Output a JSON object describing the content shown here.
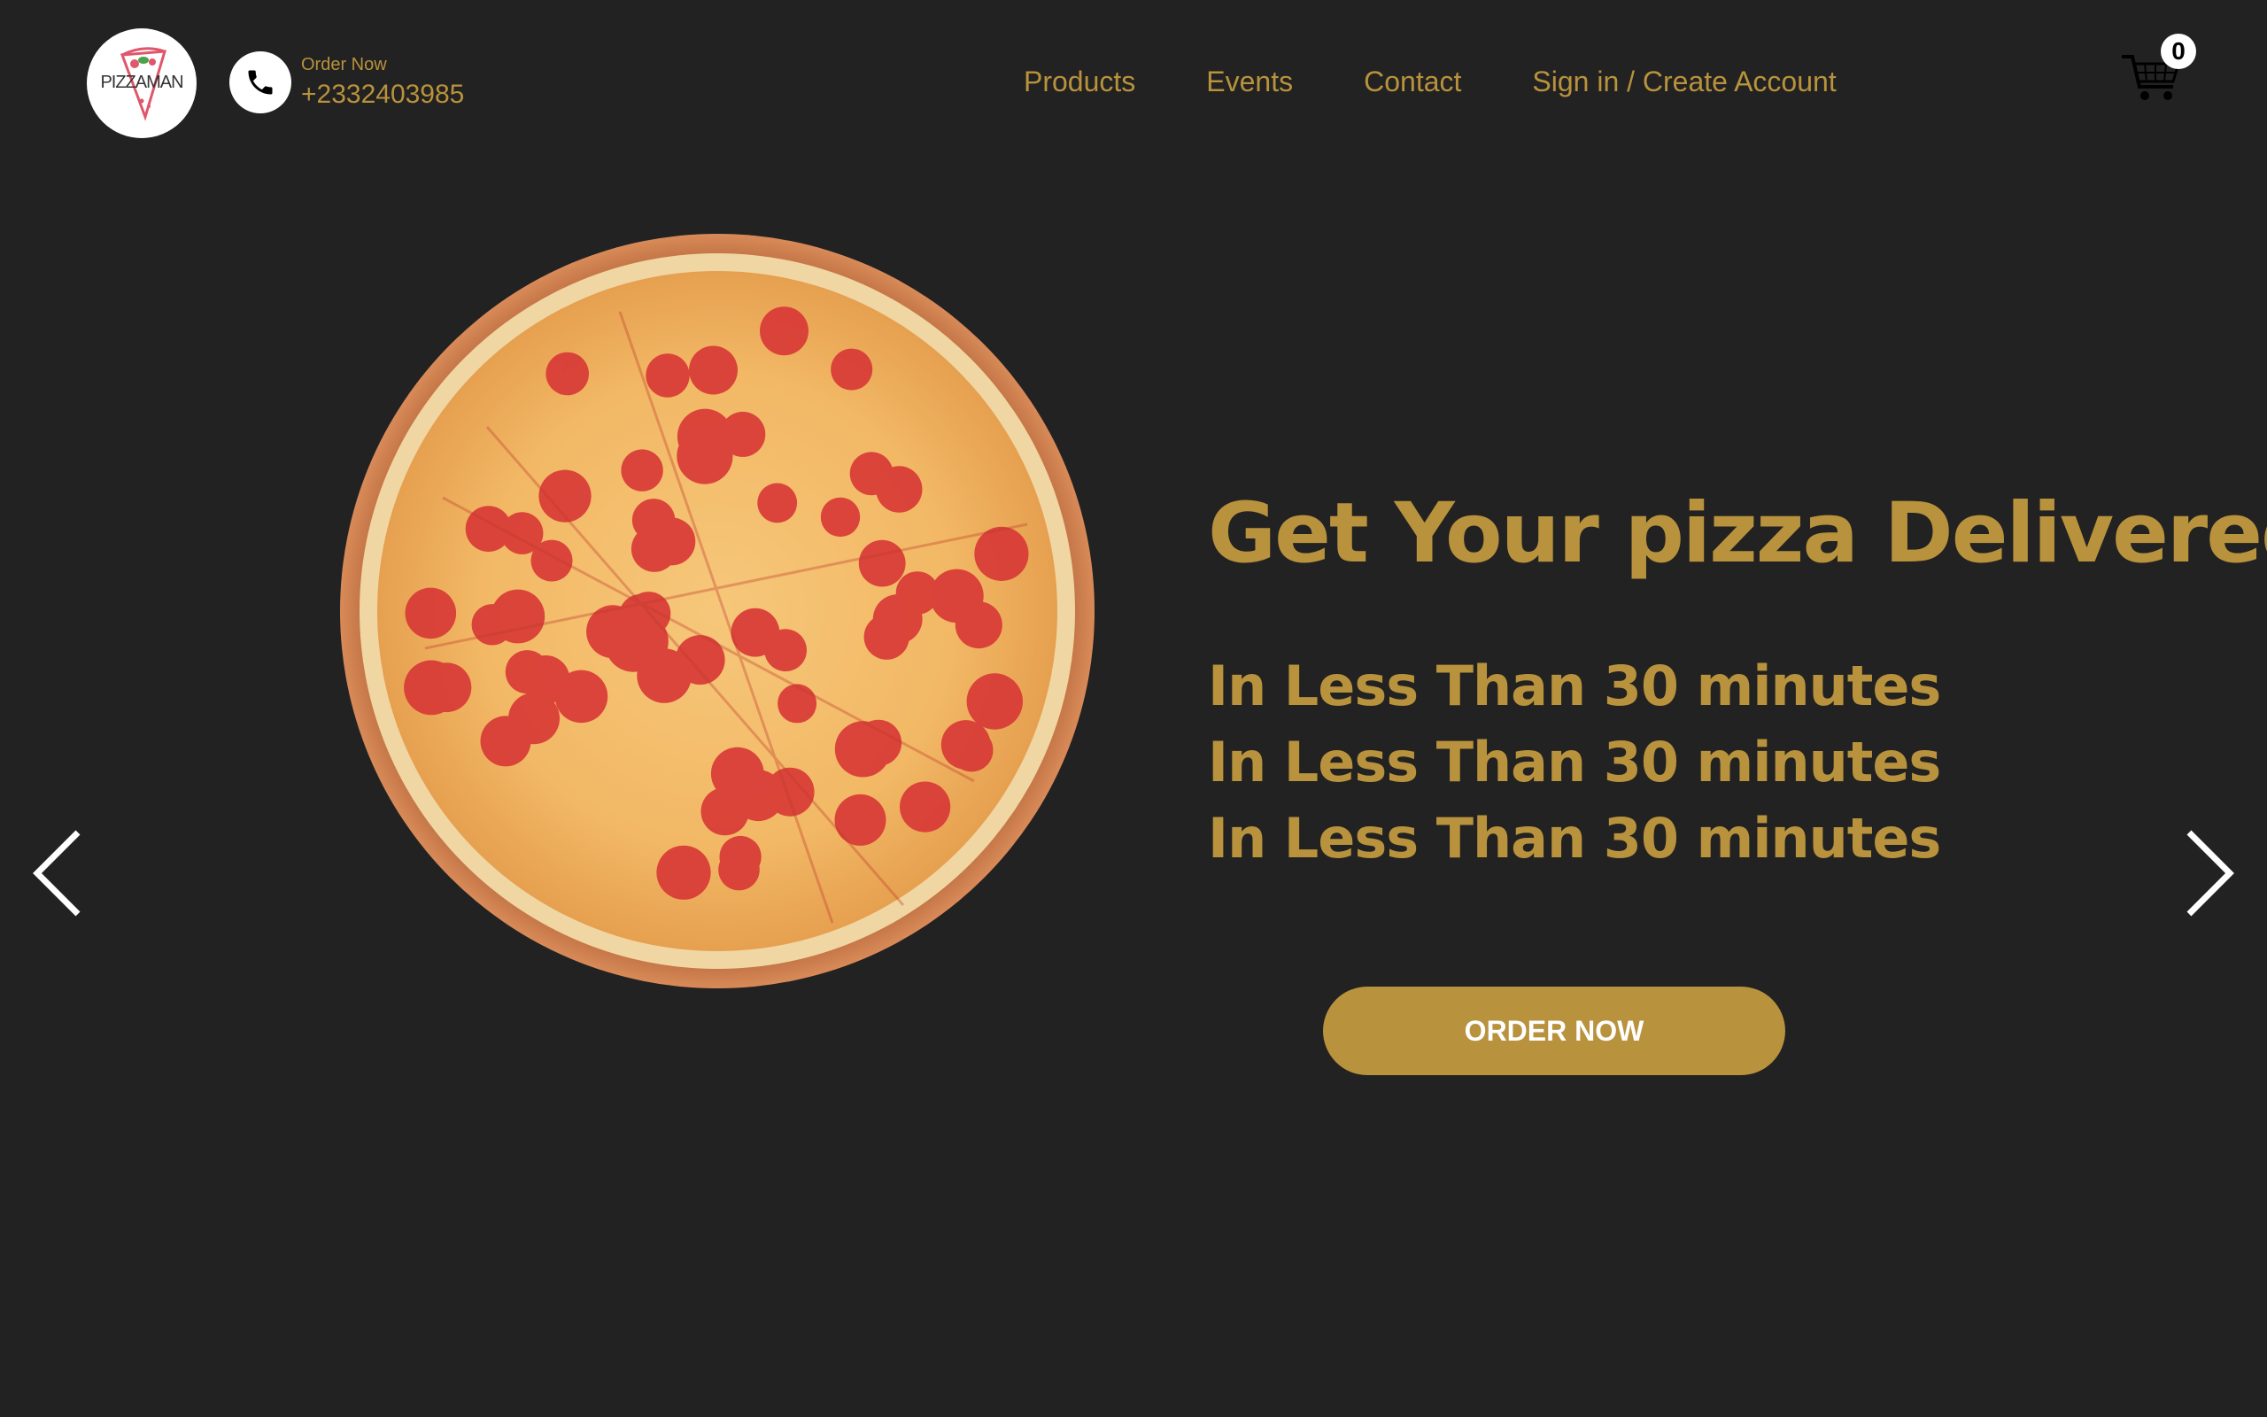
{
  "header": {
    "logo_text": "PIZZAMAN",
    "order_now_label": "Order Now",
    "phone_number": "+2332403985",
    "cart_count": "0"
  },
  "nav": {
    "items": [
      {
        "label": "Products"
      },
      {
        "label": "Events"
      },
      {
        "label": "Contact"
      },
      {
        "label": "Sign in / Create Account"
      }
    ]
  },
  "hero": {
    "title": "Get Your pizza Delivered",
    "lines": [
      "In Less Than 30 minutes",
      "In Less Than 30 minutes",
      "In Less Than 30 minutes"
    ],
    "button_label": "ORDER NOW"
  },
  "icons": {
    "phone": "phone-icon",
    "cart": "cart-icon",
    "prev": "chevron-left-icon",
    "next": "chevron-right-icon"
  },
  "colors": {
    "background": "#222222",
    "accent": "#b8923c",
    "text_light": "#ffffff"
  }
}
